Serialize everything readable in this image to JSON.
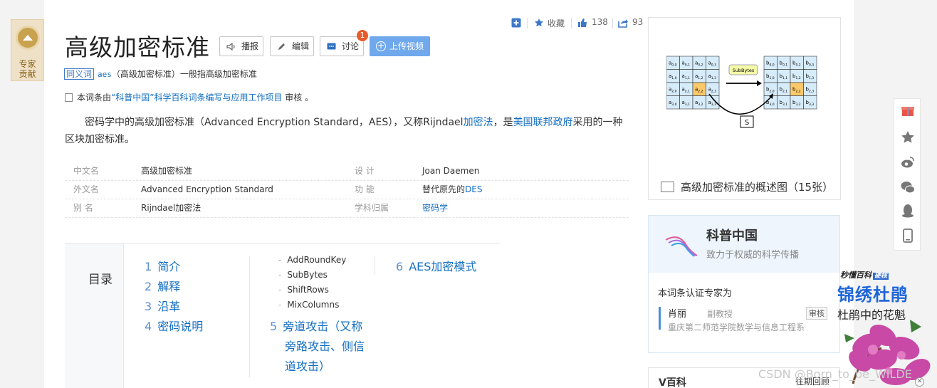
{
  "expert_badge": {
    "line1": "专家",
    "line2": "贡献"
  },
  "header": {
    "title": "高级加密标准",
    "buttons": {
      "broadcast": "播报",
      "edit": "编辑",
      "discuss": "讨论",
      "upload_video": "上传视频"
    },
    "discuss_count": "1"
  },
  "actions": {
    "favorite": "收藏",
    "likes": "138",
    "shares": "93"
  },
  "synonym": {
    "tag": "同义词",
    "term": "aes",
    "text": "（高级加密标准）一般指高级加密标准"
  },
  "certification": {
    "prefix": "本词条由",
    "link": "“科普中国”科学百科词条编写与应用工作项目",
    "suffix": " 审核 。"
  },
  "intro": {
    "part1": "密码学中的高级加密标准（Advanced Encryption Standard，AES），又称Rijndael",
    "link1": "加密法",
    "part2": "，是",
    "link2": "美国联邦政府",
    "part3": "采用的一种区块加密标准。"
  },
  "infobox": {
    "rows": [
      {
        "k1": "中文名",
        "v1": "高级加密标准",
        "k2": "设    计",
        "v2": "Joan Daemen",
        "v2_link": ""
      },
      {
        "k1": "外文名",
        "v1": "Advanced Encryption Standard",
        "k2": "功    能",
        "v2": "替代原先的",
        "v2_link": "DES"
      },
      {
        "k1": "别    名",
        "v1": "Rijndael加密法",
        "k2": "学科归属",
        "v2": "",
        "v2_link": "密码学"
      }
    ]
  },
  "toc": {
    "title": "目录",
    "items": [
      {
        "num": "1",
        "label": "简介"
      },
      {
        "num": "2",
        "label": "解释"
      },
      {
        "num": "3",
        "label": "沿革"
      },
      {
        "num": "4",
        "label": "密码说明"
      },
      {
        "num": "5",
        "label": "旁道攻击（又称",
        "label2": "旁路攻击、侧信",
        "label3": "道攻击）"
      },
      {
        "num": "6",
        "label": "AES加密模式"
      }
    ],
    "subitems": [
      "AddRoundKey",
      "SubBytes",
      "ShiftRows",
      "MixColumns"
    ]
  },
  "image_card": {
    "caption": "高级加密标准的概述图（15张）",
    "diagram": {
      "op_label": "SubBytes",
      "s_label": "S"
    }
  },
  "kepu": {
    "name": "科普中国",
    "slogan": "致力于权威的科学传播",
    "cert_label": "本词条认证专家为",
    "expert": "肖丽",
    "rank": "副教授",
    "review": "审核",
    "org": "重庆第二师范学院数学与信息工程系"
  },
  "vbaike": {
    "title": "V百科",
    "more": "往期回顾"
  },
  "ad": {
    "brand": "秒懂百科",
    "brand_tag": "硬核",
    "headline": "锦绣杜鹃",
    "sub": "杜鹃中的花魁"
  },
  "watermark": "CSDN @Born_to_be_WILDE"
}
